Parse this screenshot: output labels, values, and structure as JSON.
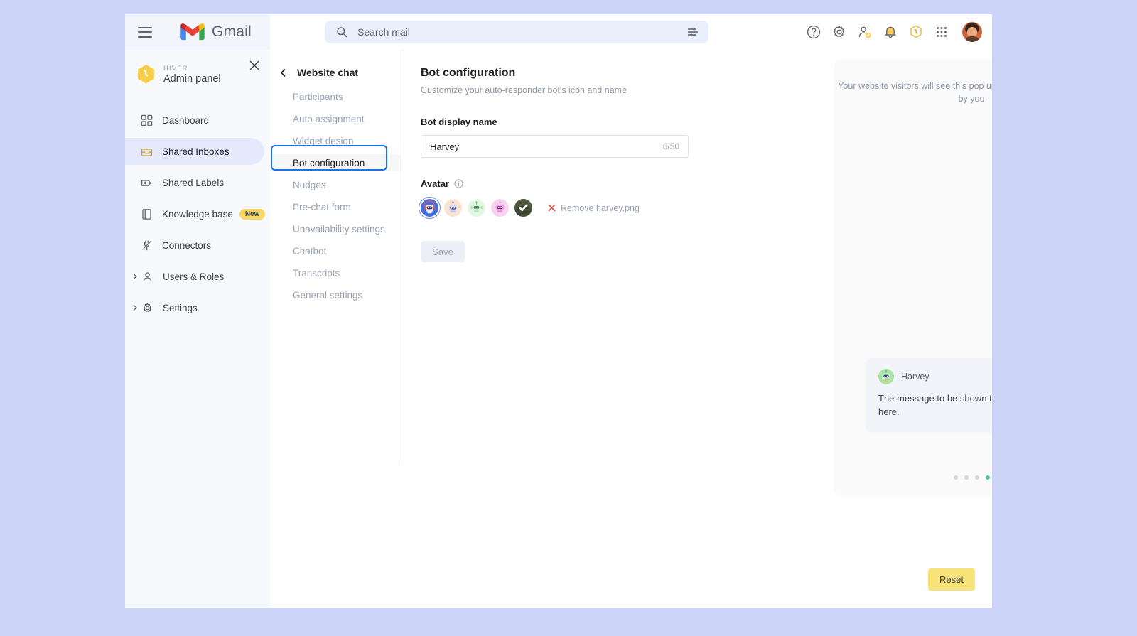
{
  "topbar": {
    "menu_icon": "hamburger-icon",
    "logo_text": "Gmail",
    "search_placeholder": "Search mail",
    "search_icon": "search-icon",
    "filter_icon": "tune-icon",
    "icons": [
      "help-icon",
      "gear-icon",
      "account-check-icon",
      "notification-bell-icon",
      "hiver-hex-icon",
      "apps-grid-icon"
    ],
    "profile": "user-avatar"
  },
  "sidebar": {
    "brand_small": "HIVER",
    "brand_title": "Admin panel",
    "close_icon": "close-icon",
    "items": [
      {
        "label": "Dashboard",
        "icon": "dashboard-grid-icon",
        "active": false,
        "badge": "",
        "expandable": false
      },
      {
        "label": "Shared Inboxes",
        "icon": "inbox-icon",
        "active": true,
        "badge": "",
        "expandable": false
      },
      {
        "label": "Shared Labels",
        "icon": "label-tag-icon",
        "active": false,
        "badge": "",
        "expandable": false
      },
      {
        "label": "Knowledge base",
        "icon": "book-icon",
        "active": false,
        "badge": "New",
        "expandable": false
      },
      {
        "label": "Connectors",
        "icon": "plug-icon",
        "active": false,
        "badge": "",
        "expandable": false
      },
      {
        "label": "Users & Roles",
        "icon": "person-icon",
        "active": false,
        "badge": "",
        "expandable": true
      },
      {
        "label": "Settings",
        "icon": "gear-icon",
        "active": false,
        "badge": "",
        "expandable": true
      }
    ]
  },
  "midnav": {
    "back_icon": "chevron-left-icon",
    "title": "Website chat",
    "items": [
      {
        "label": "Participants",
        "selected": false
      },
      {
        "label": "Auto assignment",
        "selected": false
      },
      {
        "label": "Widget design",
        "selected": false
      },
      {
        "label": "Bot configuration",
        "selected": true
      },
      {
        "label": "Nudges",
        "selected": false
      },
      {
        "label": "Pre-chat form",
        "selected": false
      },
      {
        "label": "Unavailability settings",
        "selected": false
      },
      {
        "label": "Chatbot",
        "selected": false
      },
      {
        "label": "Transcripts",
        "selected": false
      },
      {
        "label": "General settings",
        "selected": false
      }
    ]
  },
  "form": {
    "heading": "Bot configuration",
    "subheading": "Customize your auto-responder bot's icon and name",
    "name_label": "Bot display name",
    "name_value": "Harvey",
    "name_placeholder": "Bot display name",
    "char_count": "6/50",
    "avatar_label": "Avatar",
    "info_icon": "info-icon",
    "avatars": [
      {
        "name": "avatar-blue-headset-bot",
        "bg": "#3f6fe0",
        "selected": true
      },
      {
        "name": "avatar-peach-bot",
        "bg": "#fbe3d0",
        "selected": false
      },
      {
        "name": "avatar-green-bot",
        "bg": "#e4f7e0",
        "selected": false
      },
      {
        "name": "avatar-pink-bot",
        "bg": "#f6d3ee",
        "selected": false
      },
      {
        "name": "avatar-uploaded-harvey",
        "bg": "#4b5340",
        "selected": false
      }
    ],
    "remove_icon": "close-x-icon",
    "remove_label": "Remove harvey.png",
    "save_label": "Save"
  },
  "preview": {
    "note": "Your website visitors will see this pop up after the trigger time set up by you",
    "next_icon": "chevron-right-icon",
    "bubble_name": "Harvey",
    "bubble_message": "The message to be shown to visitors will appear here.",
    "dots": [
      false,
      false,
      false,
      true
    ],
    "fab_icon": "close-icon"
  },
  "footer": {
    "reset_label": "Reset"
  },
  "colors": {
    "accent_blue": "#1a73e8",
    "sidebar_active": "#e4eafb",
    "brand_yellow": "#fbd960",
    "reset_yellow": "#f8e27a",
    "fab_purple": "#5a5fd6",
    "dot_active_green": "#4ad295",
    "page_bg": "#ccd4f7"
  }
}
